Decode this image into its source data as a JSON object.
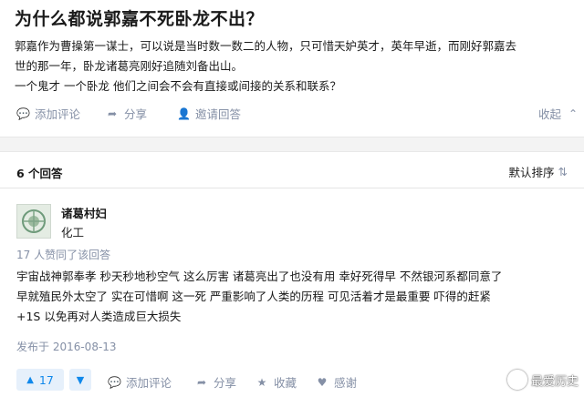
{
  "question": {
    "title": "为什么都说郭嘉不死卧龙不出？",
    "desc_lines": [
      "郭嘉作为曹操第一谋士，可以说是当时数一数二的人物，只可惜天妒英才，英年早逝，而刚好郭嘉去",
      "世的那一年，卧龙诸葛亮刚好追随刘备出山。",
      "一个鬼才 一个卧龙 他们之间会不会有直接或间接的关系和联系？"
    ],
    "actions": {
      "comment": "添加评论",
      "share": "分享",
      "invite": "邀请回答",
      "collapse": "收起"
    }
  },
  "answers_header": {
    "count": "6 个回答",
    "sort": "默认排序"
  },
  "answer": {
    "author_name": "诸葛村妇",
    "author_bio": "化工",
    "upvoted_text": "17 人赞同了该回答",
    "body_lines": [
      "宇宙战神郭奉孝 秒天秒地秒空气 这么厉害 诸葛亮出了也没有用 幸好死得早 不然银河系都同意了",
      "早就殖民外太空了 实在可惜啊 这一死 严重影响了人类的历程 可见活着才是最重要 吓得的赶紧",
      "+1S 以免再对人类造成巨大损失"
    ],
    "published": "发布于 2016-08-13",
    "votes": "17",
    "actions": {
      "comment": "添加评论",
      "share": "分享",
      "collect": "收藏",
      "thanks": "感谢"
    }
  },
  "watermark": "最爱历史",
  "icons": {
    "comment": "comment-icon",
    "share": "share-icon",
    "invite": "invite-icon",
    "collapse": "chevron-up-icon",
    "sort": "swap-icon",
    "collect": "star-icon",
    "thanks": "heart-icon",
    "vote_up": "triangle-up-icon",
    "vote_down": "triangle-down-icon"
  },
  "colors": {
    "accent": "#0f88eb",
    "meta": "#8590a6",
    "vote_bg": "#e6f0fb"
  }
}
